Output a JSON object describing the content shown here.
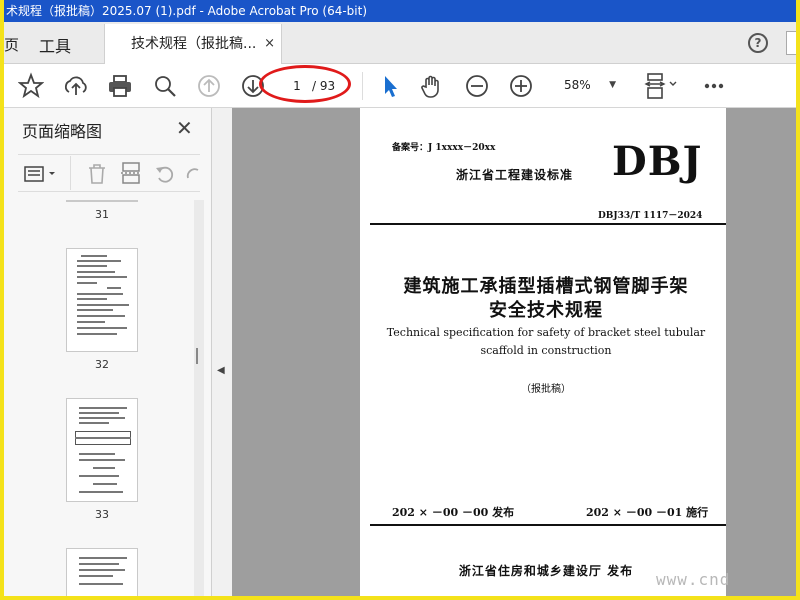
{
  "window": {
    "title": "术规程（报批稿）2025.07 (1).pdf - Adobe Acrobat Pro (64-bit)",
    "title_bar_color": "#1a55c8",
    "frame_color": "#f4e21a"
  },
  "tabs": {
    "prev": "页",
    "tools": "工具",
    "document": "技术规程（报批稿...",
    "close": "×"
  },
  "toolbar": {
    "current_page": "1",
    "total_pages": "/ 93",
    "zoom": "58%",
    "icons": [
      "star-icon",
      "upload-icon",
      "print-icon",
      "search-icon",
      "page-up-icon",
      "page-down-icon",
      "select-cursor-icon",
      "hand-icon",
      "zoom-out-icon",
      "zoom-in-icon",
      "fit-page-icon",
      "more-icon"
    ],
    "annotation_color": "#e01a1a"
  },
  "sidebar": {
    "title": "页面缩略图",
    "close": "✕",
    "thumbnails": [
      {
        "label": "31"
      },
      {
        "label": "32"
      },
      {
        "label": "33"
      }
    ]
  },
  "document_page": {
    "record_no": "备案号：J 1xxxx－20xx",
    "brand": "DBJ",
    "standard_name": "浙江省工程建设标准",
    "code": "DBJ33/T 1117－2024",
    "title_line1": "建筑施工承插型插槽式钢管脚手架",
    "title_line2": "安全技术规程",
    "english_line1": "Technical specification for safety of bracket steel tubular",
    "english_line2": "scaffold in construction",
    "draft_note": "（报批稿）",
    "issue_date": "202 × －00 －00 发布",
    "implement_date": "202 × －00 －01 施行",
    "publisher": "浙江省住房和城乡建设厅  发布"
  },
  "watermark": {
    "bottom": "www.cnd"
  }
}
